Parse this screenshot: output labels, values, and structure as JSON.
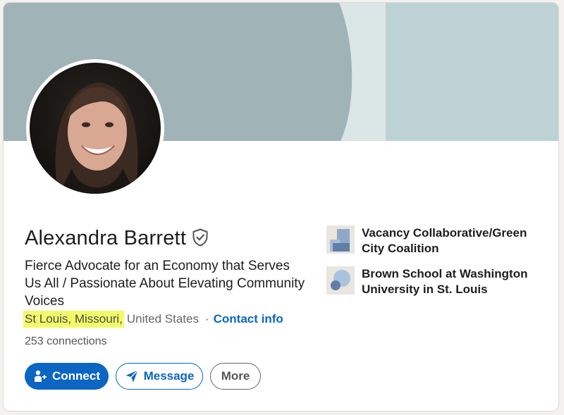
{
  "profile": {
    "name": "Alexandra Barrett",
    "headline": "Fierce Advocate for an Economy that Serves Us All / Passionate About Elevating Community Voices",
    "location_highlighted": "St Louis, Missouri,",
    "location_country": "United States",
    "separator": "·",
    "contact_info_label": "Contact info",
    "connections_count": "253",
    "connections_label": "connections"
  },
  "organizations": [
    {
      "name": "Vacancy Collaborative/Green City Coalition",
      "logo": "building-logo-icon"
    },
    {
      "name": "Brown School at Washington University in St. Louis",
      "logo": "school-logo-icon"
    }
  ],
  "actions": {
    "connect_label": "Connect",
    "message_label": "Message",
    "more_label": "More"
  },
  "icons": {
    "verified": "verified-shield-icon",
    "connect": "add-person-icon",
    "message": "send-arrow-icon"
  },
  "colors": {
    "primary": "#0a66c2",
    "highlight": "#f2fa6a",
    "banner_dark": "#a0b3b6",
    "banner_light": "#bdd2d5"
  }
}
